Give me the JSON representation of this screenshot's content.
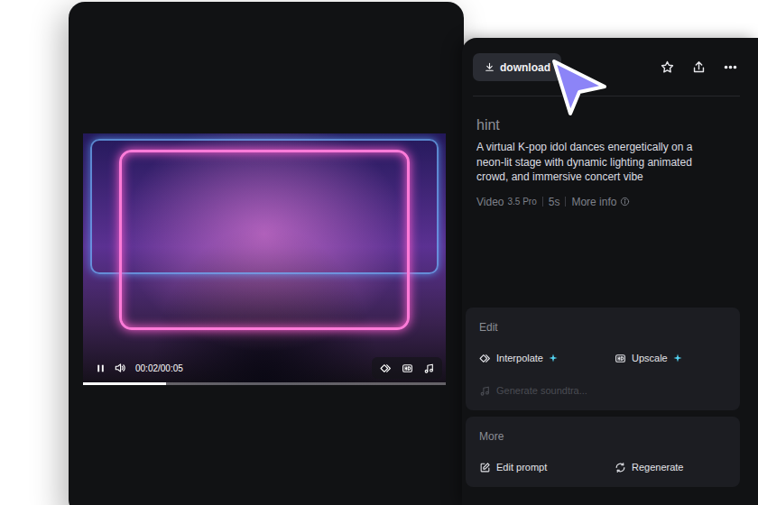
{
  "player": {
    "playing": true,
    "time": "00:02/00:05",
    "level": 0.23
  },
  "toolbar": {
    "download": "download"
  },
  "details": {
    "title": "hint",
    "prompt": "A virtual K-pop idol dances energetically on a neon-lit stage with dynamic lighting animated crowd, and immersive concert vibe",
    "model": "Video",
    "version": "3.5 Pro",
    "duration": "5s",
    "info": "More info"
  },
  "edit": {
    "title": "Edit",
    "actions": [
      {
        "label": "Interpolate",
        "premium": true,
        "disabled": false
      },
      {
        "label": "Upscale",
        "premium": true,
        "disabled": false
      },
      {
        "label": "Generate soundtra...",
        "premium": false,
        "disabled": true
      }
    ]
  },
  "more": {
    "title": "More",
    "actions": [
      {
        "label": "Edit prompt"
      },
      {
        "label": "Regenerate"
      }
    ]
  }
}
